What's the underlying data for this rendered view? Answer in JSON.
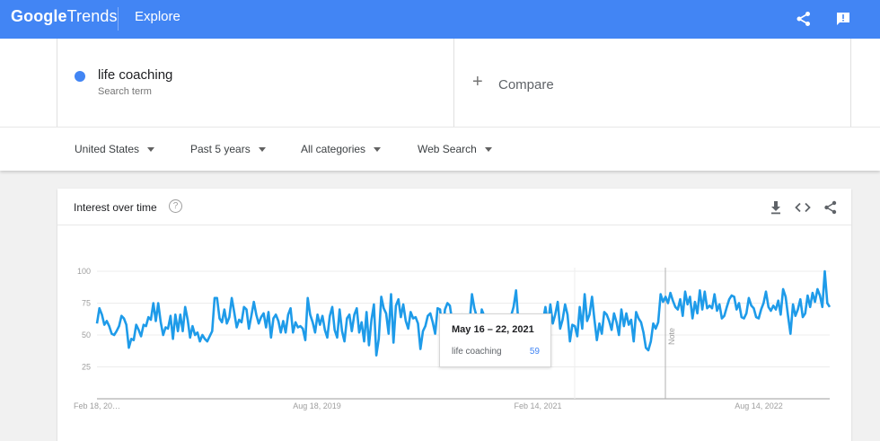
{
  "header": {
    "brand_google": "Google",
    "brand_trends": "Trends",
    "page": "Explore",
    "icons": [
      "share-icon",
      "feedback-icon"
    ]
  },
  "search": {
    "term": "life coaching",
    "term_type": "Search term",
    "term_color": "#4285f4",
    "compare_label": "Compare"
  },
  "filters": {
    "region": "United States",
    "period": "Past 5 years",
    "category": "All categories",
    "property": "Web Search"
  },
  "card": {
    "title": "Interest over time",
    "help": "?",
    "icons": [
      "download-icon",
      "embed-icon",
      "share-icon"
    ]
  },
  "tooltip": {
    "date": "May 16 – 22, 2021",
    "term": "life coaching",
    "value": "59"
  },
  "chart_data": {
    "type": "line",
    "series": [
      {
        "name": "life coaching",
        "color": "#1e9be9",
        "values": [
          59,
          71,
          66,
          58,
          61,
          57,
          51,
          50,
          53,
          57,
          65,
          63,
          58,
          40,
          47,
          46,
          58,
          54,
          49,
          58,
          57,
          64,
          62,
          75,
          61,
          75,
          60,
          50,
          56,
          55,
          65,
          47,
          66,
          53,
          66,
          53,
          72,
          62,
          48,
          57,
          50,
          52,
          45,
          50,
          47,
          45,
          49,
          53,
          79,
          79,
          63,
          60,
          70,
          59,
          64,
          79,
          68,
          56,
          62,
          60,
          72,
          70,
          55,
          65,
          76,
          66,
          59,
          64,
          67,
          56,
          68,
          48,
          63,
          66,
          61,
          52,
          61,
          52,
          66,
          71,
          52,
          60,
          56,
          57,
          55,
          46,
          79,
          66,
          60,
          52,
          66,
          58,
          65,
          54,
          48,
          65,
          72,
          54,
          48,
          70,
          53,
          45,
          63,
          66,
          53,
          66,
          71,
          52,
          60,
          45,
          68,
          42,
          62,
          74,
          34,
          47,
          80,
          71,
          67,
          51,
          82,
          44,
          73,
          78,
          64,
          74,
          61,
          55,
          68,
          63,
          64,
          59,
          39,
          53,
          57,
          65,
          67,
          60,
          51,
          71,
          70,
          48,
          70,
          75,
          73,
          60,
          36,
          54,
          63,
          66,
          44,
          62,
          58,
          82,
          71,
          64,
          48,
          70,
          65,
          60,
          63,
          59,
          56,
          50,
          58,
          58,
          46,
          40,
          60,
          65,
          72,
          85,
          59,
          50,
          60,
          38,
          47,
          64,
          57,
          55,
          55,
          52,
          61,
          72,
          58,
          74,
          59,
          66,
          76,
          55,
          62,
          74,
          66,
          45,
          58,
          57,
          49,
          72,
          55,
          82,
          61,
          66,
          80,
          62,
          46,
          59,
          51,
          68,
          66,
          61,
          54,
          67,
          60,
          50,
          70,
          57,
          67,
          58,
          62,
          45,
          68,
          63,
          60,
          52,
          40,
          38,
          45,
          59,
          55,
          60,
          82,
          76,
          80,
          75,
          83,
          77,
          72,
          70,
          78,
          65,
          84,
          74,
          80,
          63,
          76,
          67,
          85,
          70,
          84,
          71,
          73,
          71,
          82,
          69,
          74,
          63,
          65,
          72,
          78,
          81,
          80,
          70,
          75,
          64,
          63,
          67,
          79,
          73,
          71,
          64,
          63,
          70,
          75,
          84,
          72,
          69,
          73,
          70,
          77,
          66,
          86,
          80,
          65,
          51,
          74,
          65,
          70,
          78,
          64,
          67,
          81,
          72,
          83,
          76,
          86,
          81,
          72,
          100,
          75,
          72
        ]
      }
    ],
    "x_tick_labels": [
      "Feb 18, 20…",
      "Aug 18, 2019",
      "Feb 14, 2021",
      "Aug 14, 2022"
    ],
    "y_ticks": [
      100,
      75,
      50,
      25
    ],
    "ylim": [
      0,
      100
    ],
    "annotations": [
      "Note"
    ],
    "grid": true
  }
}
